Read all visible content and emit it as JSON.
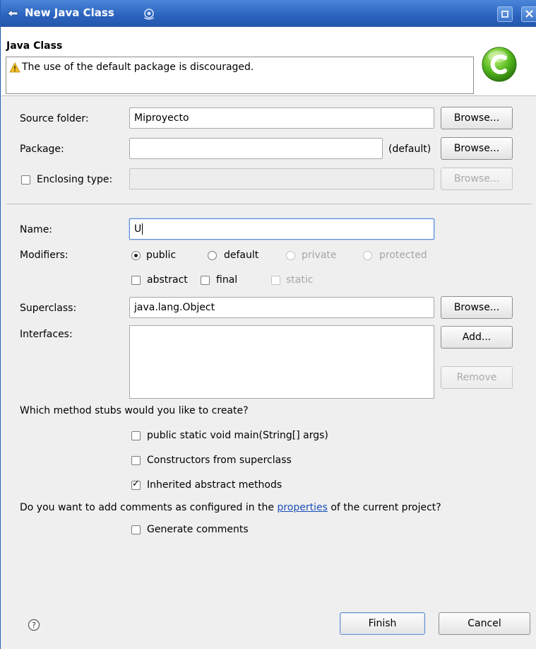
{
  "window": {
    "title": "New Java Class"
  },
  "header": {
    "title": "Java Class",
    "message": "The use of the default package is discouraged."
  },
  "source_folder": {
    "label": "Source folder:",
    "value": "Miproyecto",
    "browse": "Browse..."
  },
  "package": {
    "label": "Package:",
    "value": "",
    "default_hint": "(default)",
    "browse": "Browse..."
  },
  "enclosing_type": {
    "label": "Enclosing type:",
    "checked": false,
    "value": "",
    "browse": "Browse..."
  },
  "name": {
    "label": "Name:",
    "value": "U"
  },
  "modifiers": {
    "label": "Modifiers:",
    "access": [
      {
        "label": "public",
        "selected": true,
        "enabled": true
      },
      {
        "label": "default",
        "selected": false,
        "enabled": true
      },
      {
        "label": "private",
        "selected": false,
        "enabled": false
      },
      {
        "label": "protected",
        "selected": false,
        "enabled": false
      }
    ],
    "other": [
      {
        "label": "abstract",
        "checked": false,
        "enabled": true
      },
      {
        "label": "final",
        "checked": false,
        "enabled": true
      },
      {
        "label": "static",
        "checked": false,
        "enabled": false
      }
    ]
  },
  "superclass": {
    "label": "Superclass:",
    "value": "java.lang.Object",
    "browse": "Browse..."
  },
  "interfaces": {
    "label": "Interfaces:",
    "add": "Add...",
    "remove": "Remove"
  },
  "stubs": {
    "question": "Which method stubs would you like to create?",
    "options": [
      {
        "label": "public static void main(String[] args)",
        "checked": false
      },
      {
        "label": "Constructors from superclass",
        "checked": false
      },
      {
        "label": "Inherited abstract methods",
        "checked": true
      }
    ]
  },
  "comments": {
    "question_before": "Do you want to add comments as configured in the ",
    "link": "properties",
    "question_after": " of the current project?",
    "generate": "Generate comments",
    "checked": false
  },
  "footer": {
    "finish": "Finish",
    "cancel": "Cancel"
  },
  "colors": {
    "titlebar": "#2a62bd",
    "link": "#1a4fb8"
  }
}
